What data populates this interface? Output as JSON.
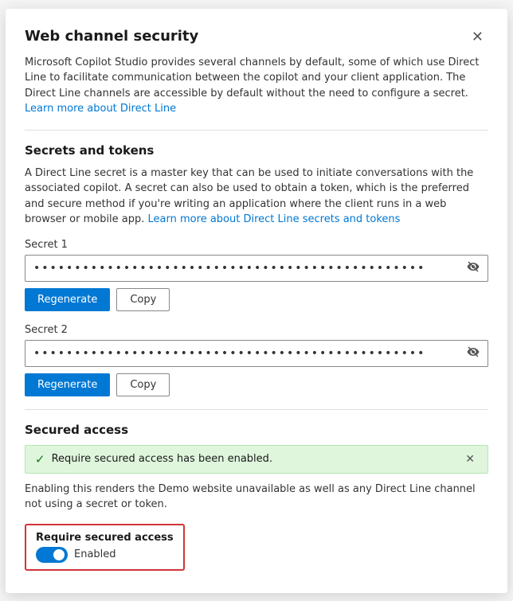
{
  "modal": {
    "title": "Web channel security",
    "close_label": "✕"
  },
  "intro": {
    "text": "Microsoft Copilot Studio provides several channels by default, some of which use Direct Line to facilitate communication between the copilot and your client application. The Direct Line channels are accessible by default without the need to configure a secret.",
    "link_text": "Learn more about Direct Line",
    "link_href": "#"
  },
  "secrets_section": {
    "title": "Secrets and tokens",
    "description": "A Direct Line secret is a master key that can be used to initiate conversations with the associated copilot. A secret can also be used to obtain a token, which is the preferred and secure method if you're writing an application where the client runs in a web browser or mobile app.",
    "link_text": "Learn more about Direct Line secrets and tokens",
    "link_href": "#"
  },
  "secret1": {
    "label": "Secret 1",
    "value": "••••••••••••••••••••••••••••••••••••••••••••••••",
    "regenerate_label": "Regenerate",
    "copy_label": "Copy",
    "eye_icon": "👁"
  },
  "secret2": {
    "label": "Secret 2",
    "value": "••••••••••••••••••••••••••••••••••••••••••••••••",
    "regenerate_label": "Regenerate",
    "copy_label": "Copy",
    "eye_icon": "👁"
  },
  "secured_access": {
    "title": "Secured access",
    "banner_text": "Require secured access has been enabled.",
    "description": "Enabling this renders the Demo website unavailable as well as any Direct Line channel not using a secret or token.",
    "toggle_label": "Require secured access",
    "toggle_status": "Enabled",
    "toggle_enabled": true
  }
}
